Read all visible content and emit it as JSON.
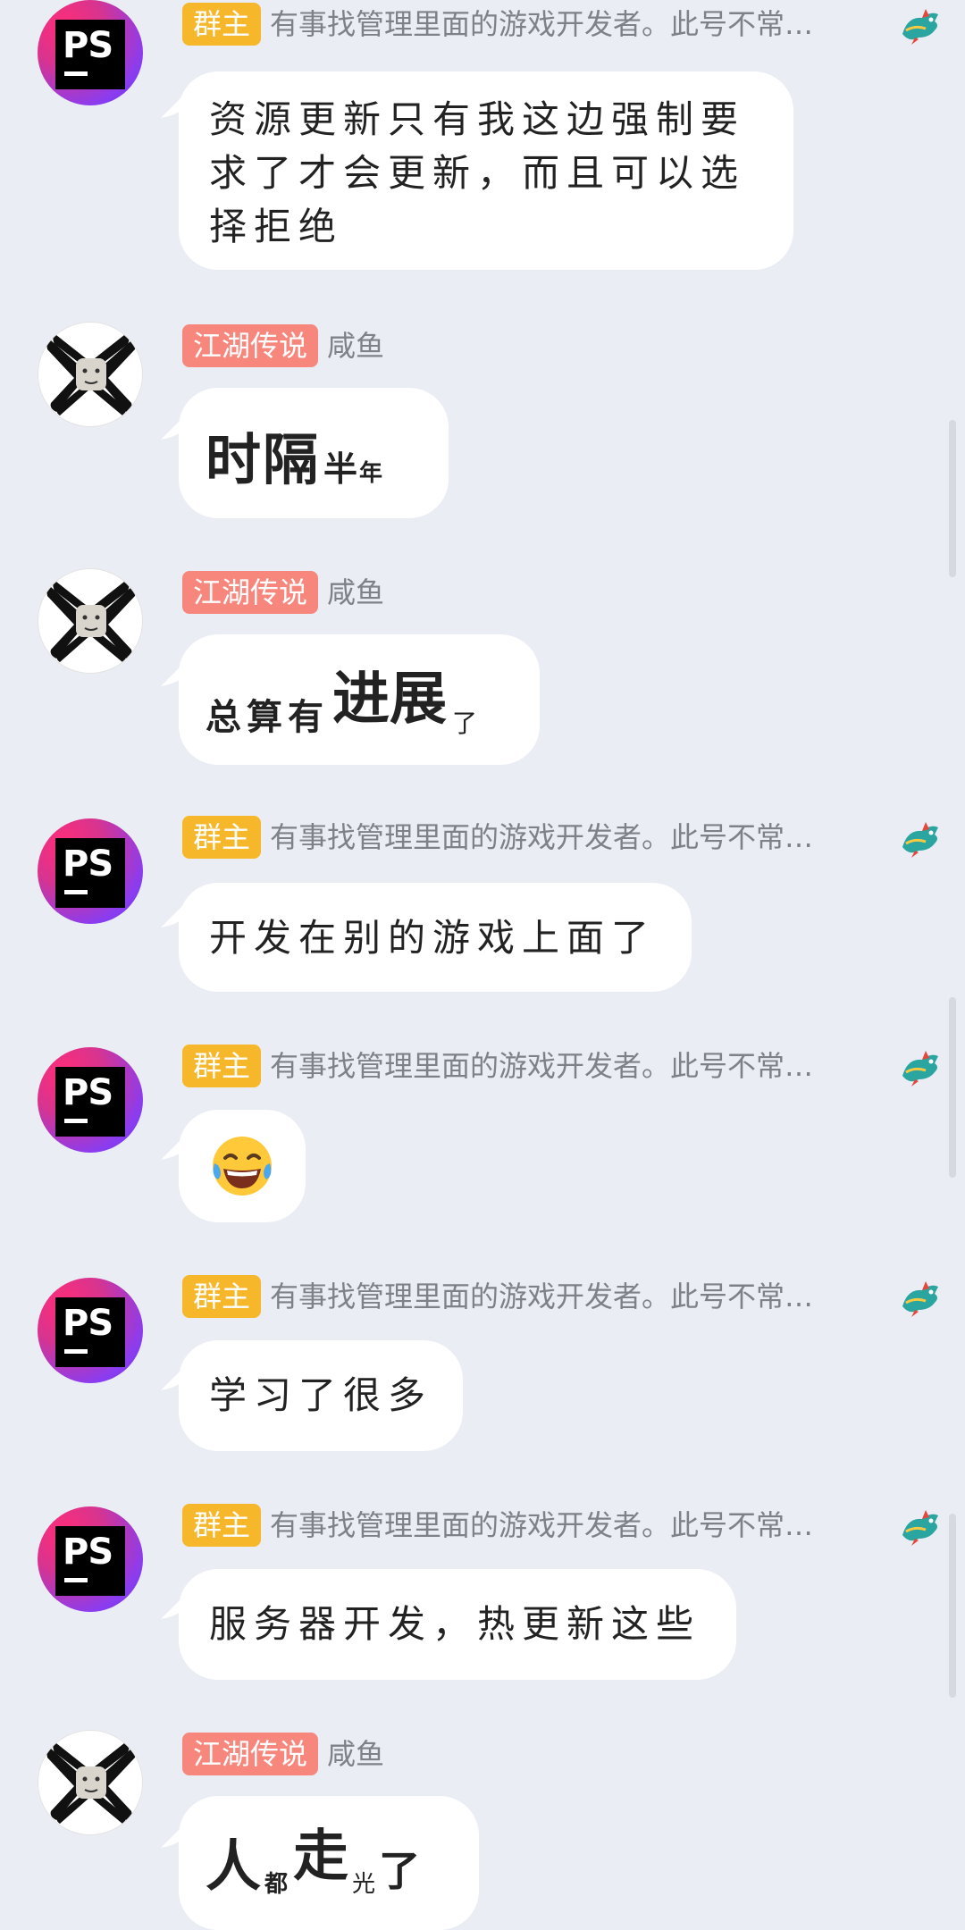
{
  "badges": {
    "owner": "群主",
    "legend": "江湖传说"
  },
  "senders": {
    "owner_name": "有事找管理里面的游戏开发者。此号不常…",
    "fish_name": "咸鱼"
  },
  "avatar": {
    "ps_text": "PS"
  },
  "messages": [
    {
      "sender": "owner",
      "text": "资源更新只有我这边强制要求了才会更新，而且可以选择拒绝"
    },
    {
      "sender": "fish",
      "parts": [
        "时隔",
        "半",
        "年"
      ]
    },
    {
      "sender": "fish",
      "parts": [
        "总算有",
        "进展",
        "了"
      ]
    },
    {
      "sender": "owner",
      "text": "开发在别的游戏上面了"
    },
    {
      "sender": "owner",
      "emoji": "😂"
    },
    {
      "sender": "owner",
      "text": "学习了很多"
    },
    {
      "sender": "owner",
      "text": "服务器开发，热更新这些"
    },
    {
      "sender": "fish",
      "parts": [
        "人",
        "都",
        "走",
        "光",
        "了"
      ]
    }
  ],
  "msg_texts": {
    "m1_line1": "资源更新只有我这边强制要",
    "m1_line2": "求了才会更新，而且可以选",
    "m1_line3": "择拒绝",
    "m2_a": "时隔",
    "m2_b": "半",
    "m2_c": "年",
    "m3_a": "总算有",
    "m3_b": "进展",
    "m3_c": "了",
    "m4": "开发在别的游戏上面了",
    "m5": "😂",
    "m6": "学习了很多",
    "m7": "服务器开发，热更新这些",
    "m8_a": "人",
    "m8_b": "都",
    "m8_c": "走",
    "m8_d": "光",
    "m8_e": "了"
  },
  "colors": {
    "background": "#ebedf5",
    "badge_owner": "#f6b72b",
    "badge_legend": "#f7877d",
    "bubble": "#ffffff",
    "name_gray": "#7f8189"
  },
  "icons": [
    "ps-avatar-icon",
    "x-meme-avatar-icon",
    "dragon-level-icon",
    "laughing-tears-emoji-icon"
  ]
}
